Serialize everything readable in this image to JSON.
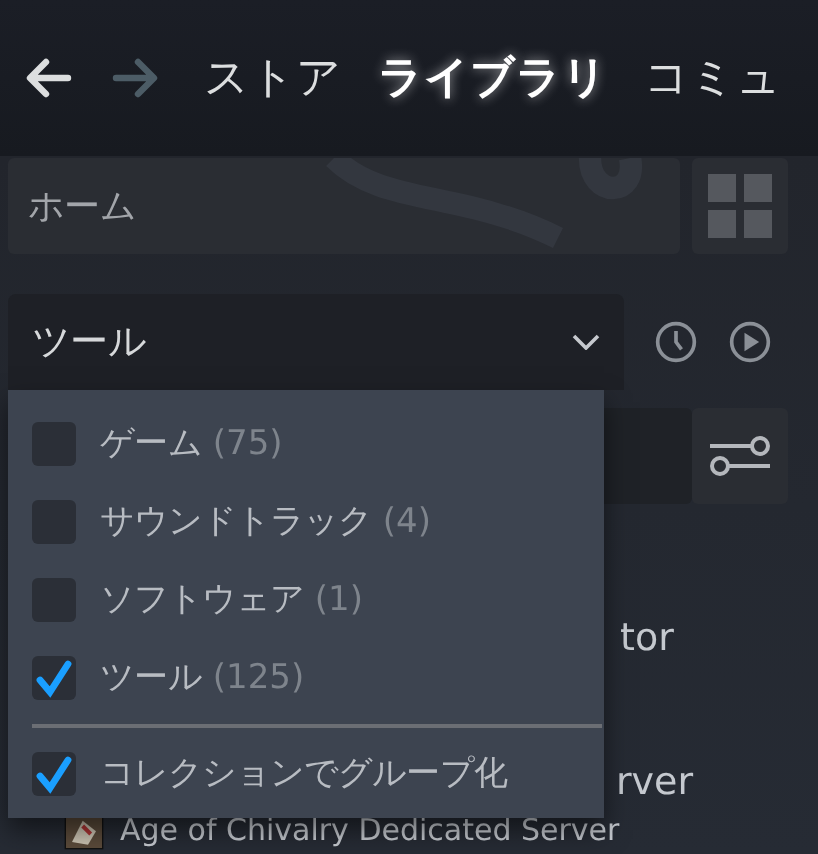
{
  "nav": {
    "tabs": [
      {
        "label": "ストア",
        "selected": false
      },
      {
        "label": "ライブラリ",
        "selected": true
      },
      {
        "label": "コミュ",
        "selected": false
      }
    ],
    "back_disabled": false,
    "forward_disabled": true
  },
  "home": {
    "label": "ホーム"
  },
  "filter": {
    "value": "ツール",
    "expanded": true
  },
  "menu": {
    "items": [
      {
        "label": "ゲーム",
        "count": "(75)",
        "checked": false
      },
      {
        "label": "サウンドトラック",
        "count": "(4)",
        "checked": false
      },
      {
        "label": "ソフトウェア",
        "count": "(1)",
        "checked": false
      },
      {
        "label": "ツール",
        "count": "(125)",
        "checked": true
      }
    ],
    "group_option": {
      "label": "コレクションでグループ化",
      "checked": true
    }
  },
  "list": [
    {
      "text": "tor"
    },
    {
      "text": "rver"
    }
  ],
  "bottom_game": {
    "title": "Age of Chivalry Dedicated Server"
  }
}
